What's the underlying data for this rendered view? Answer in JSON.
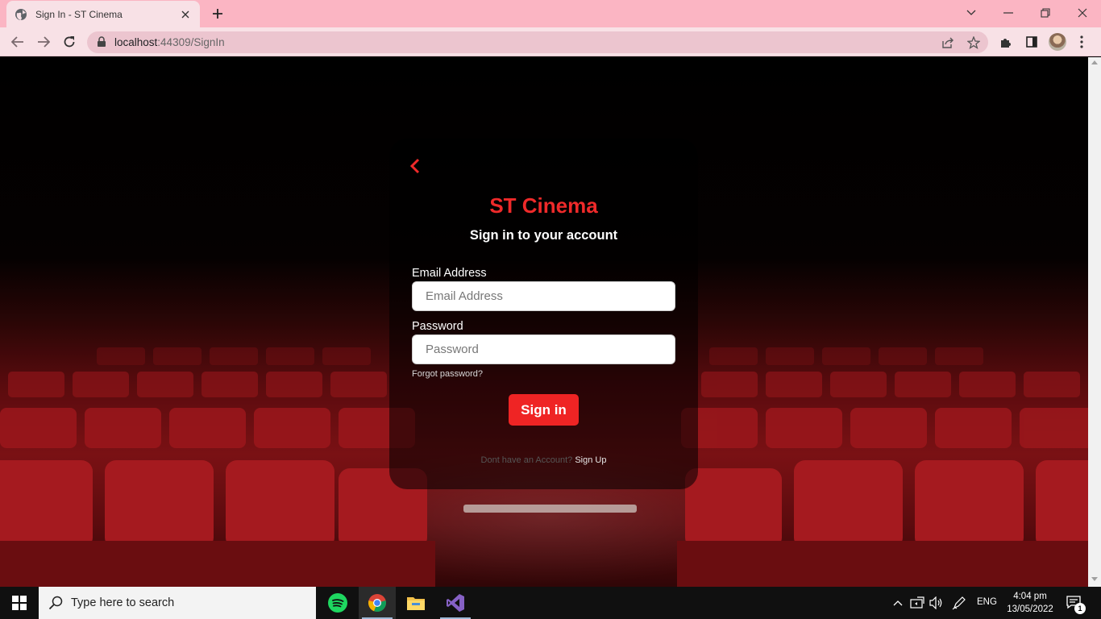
{
  "browser": {
    "tab_title": "Sign In - ST Cinema",
    "url_host": "localhost",
    "url_rest": ":44309/SignIn"
  },
  "page": {
    "brand": "ST Cinema",
    "subtitle": "Sign in to your account",
    "email_label": "Email Address",
    "email_placeholder": "Email Address",
    "email_value": "",
    "password_label": "Password",
    "password_placeholder": "Password",
    "password_value": "",
    "forgot_password": "Forgot password?",
    "sign_in": "Sign in",
    "signup_prefix": "Dont have an Account?",
    "signup_link": "Sign Up"
  },
  "taskbar": {
    "search_placeholder": "Type here to search",
    "language": "ENG",
    "time": "4:04 pm",
    "date": "13/05/2022",
    "notification_count": "1"
  },
  "colors": {
    "accent": "#ef2424",
    "tab_strip": "#fbb5c3",
    "toolbar": "#f8e1e6"
  }
}
